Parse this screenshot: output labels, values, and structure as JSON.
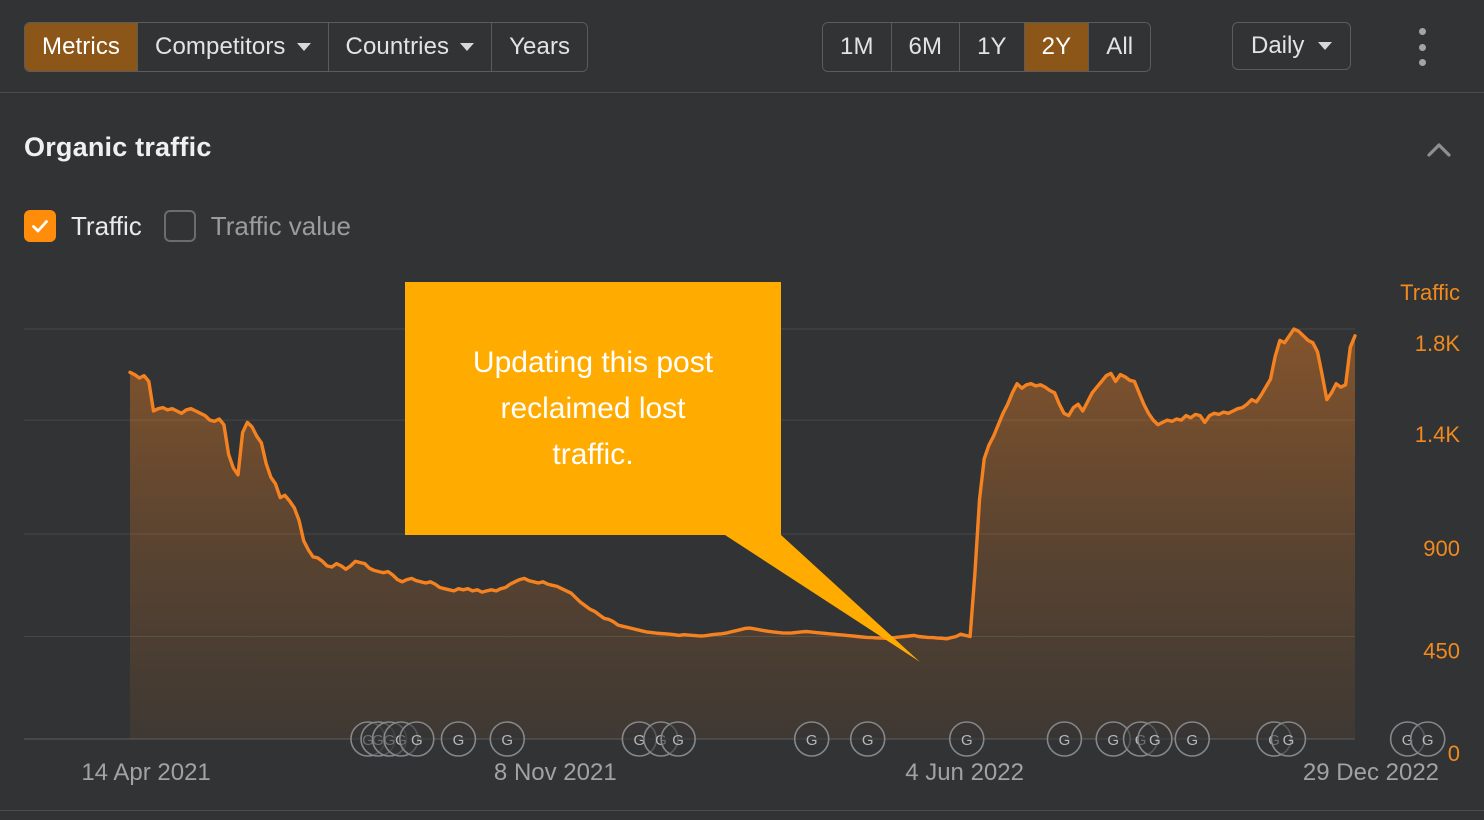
{
  "toolbar": {
    "left_group": [
      {
        "label": "Metrics",
        "active": true,
        "caret": false
      },
      {
        "label": "Competitors",
        "active": false,
        "caret": true
      },
      {
        "label": "Countries",
        "active": false,
        "caret": true
      },
      {
        "label": "Years",
        "active": false,
        "caret": false
      }
    ],
    "range_group": [
      {
        "label": "1M",
        "active": false
      },
      {
        "label": "6M",
        "active": false
      },
      {
        "label": "1Y",
        "active": false
      },
      {
        "label": "2Y",
        "active": true
      },
      {
        "label": "All",
        "active": false
      }
    ],
    "granularity": {
      "label": "Daily"
    },
    "more_menu": "kebab-menu"
  },
  "section": {
    "title": "Organic traffic",
    "collapse_icon": "chevron-up-icon"
  },
  "legend": {
    "items": [
      {
        "label": "Traffic",
        "checked": true
      },
      {
        "label": "Traffic value",
        "checked": false
      }
    ]
  },
  "colors": {
    "background": "#313335",
    "accent_orange": "#ff8c0a",
    "line_orange": "#f58220",
    "active_tab": "#8b5618",
    "axis_text": "#f08a1e",
    "callout_bg": "#ffab00",
    "grid": "#454749",
    "muted_text": "#a0a2a4"
  },
  "callout": {
    "lines": [
      "Updating this post",
      "reclaimed lost",
      "traffic."
    ],
    "background": "#ffab00",
    "text_color": "#ffffff"
  },
  "chart_data": {
    "type": "area",
    "title": "Organic traffic",
    "xlabel": "",
    "ylabel": "Traffic",
    "ylim": [
      0,
      2000
    ],
    "grid": true,
    "legend_position": "top-left",
    "y_ticks": [
      {
        "value": 1800,
        "label": "1.8K"
      },
      {
        "value": 1400,
        "label": "1.4K"
      },
      {
        "value": 900,
        "label": "900"
      },
      {
        "value": 450,
        "label": "450"
      },
      {
        "value": 0,
        "label": "0"
      }
    ],
    "x_ticks": [
      {
        "label": "14 Apr 2021",
        "x_frac": 0.085
      },
      {
        "label": "8 Nov 2021",
        "x_frac": 0.37
      },
      {
        "label": "4 Jun 2022",
        "x_frac": 0.655
      },
      {
        "label": "29 Dec 2022",
        "x_frac": 0.938
      }
    ],
    "axis_title": "Traffic",
    "series": [
      {
        "name": "Traffic",
        "color": "#f58220",
        "values": [
          1610,
          1600,
          1585,
          1595,
          1570,
          1440,
          1450,
          1455,
          1445,
          1450,
          1440,
          1430,
          1445,
          1450,
          1440,
          1430,
          1420,
          1400,
          1395,
          1405,
          1380,
          1250,
          1190,
          1160,
          1345,
          1390,
          1370,
          1330,
          1300,
          1210,
          1150,
          1120,
          1060,
          1070,
          1045,
          1015,
          960,
          870,
          830,
          800,
          795,
          780,
          760,
          755,
          770,
          760,
          745,
          760,
          780,
          775,
          770,
          750,
          740,
          735,
          730,
          735,
          720,
          700,
          690,
          700,
          705,
          695,
          690,
          685,
          690,
          680,
          665,
          660,
          655,
          650,
          660,
          655,
          660,
          650,
          655,
          645,
          650,
          655,
          650,
          660,
          665,
          680,
          690,
          700,
          705,
          695,
          690,
          685,
          690,
          680,
          675,
          670,
          660,
          650,
          640,
          620,
          600,
          585,
          570,
          560,
          545,
          530,
          525,
          515,
          500,
          495,
          490,
          485,
          480,
          475,
          470,
          468,
          465,
          463,
          462,
          460,
          458,
          455,
          458,
          456,
          455,
          453,
          452,
          455,
          458,
          460,
          462,
          465,
          470,
          475,
          480,
          485,
          487,
          484,
          480,
          476,
          473,
          470,
          468,
          466,
          465,
          466,
          468,
          470,
          472,
          470,
          468,
          466,
          464,
          462,
          460,
          458,
          456,
          454,
          452,
          450,
          448,
          446,
          445,
          444,
          443,
          442,
          443,
          445,
          448,
          450,
          452,
          455,
          450,
          448,
          446,
          445,
          443,
          442,
          440,
          445,
          450,
          460,
          455,
          450,
          720,
          1050,
          1230,
          1290,
          1330,
          1380,
          1430,
          1470,
          1520,
          1560,
          1540,
          1555,
          1560,
          1550,
          1555,
          1545,
          1530,
          1520,
          1470,
          1430,
          1420,
          1455,
          1470,
          1440,
          1480,
          1520,
          1545,
          1570,
          1595,
          1605,
          1570,
          1600,
          1590,
          1575,
          1570,
          1520,
          1470,
          1430,
          1400,
          1380,
          1390,
          1400,
          1395,
          1405,
          1400,
          1420,
          1410,
          1425,
          1420,
          1390,
          1420,
          1430,
          1425,
          1435,
          1430,
          1440,
          1450,
          1455,
          1470,
          1490,
          1480,
          1510,
          1545,
          1580,
          1680,
          1750,
          1740,
          1770,
          1800,
          1790,
          1770,
          1750,
          1740,
          1700,
          1600,
          1490,
          1520,
          1560,
          1545,
          1555,
          1720,
          1770
        ]
      }
    ],
    "annotations": [
      {
        "type": "callout",
        "text": "Updating this post reclaimed lost traffic.",
        "points_to": {
          "x_frac": 0.617,
          "value": 455
        }
      }
    ],
    "update_markers": {
      "icon": "google-update-icon",
      "label": "G",
      "x_fracs": [
        0.149,
        0.156,
        0.164,
        0.172,
        0.183,
        0.212,
        0.246,
        0.338,
        0.353,
        0.365,
        0.458,
        0.497,
        0.566,
        0.634,
        0.668,
        0.687,
        0.697,
        0.723,
        0.78,
        0.79,
        0.873,
        0.887
      ]
    }
  }
}
